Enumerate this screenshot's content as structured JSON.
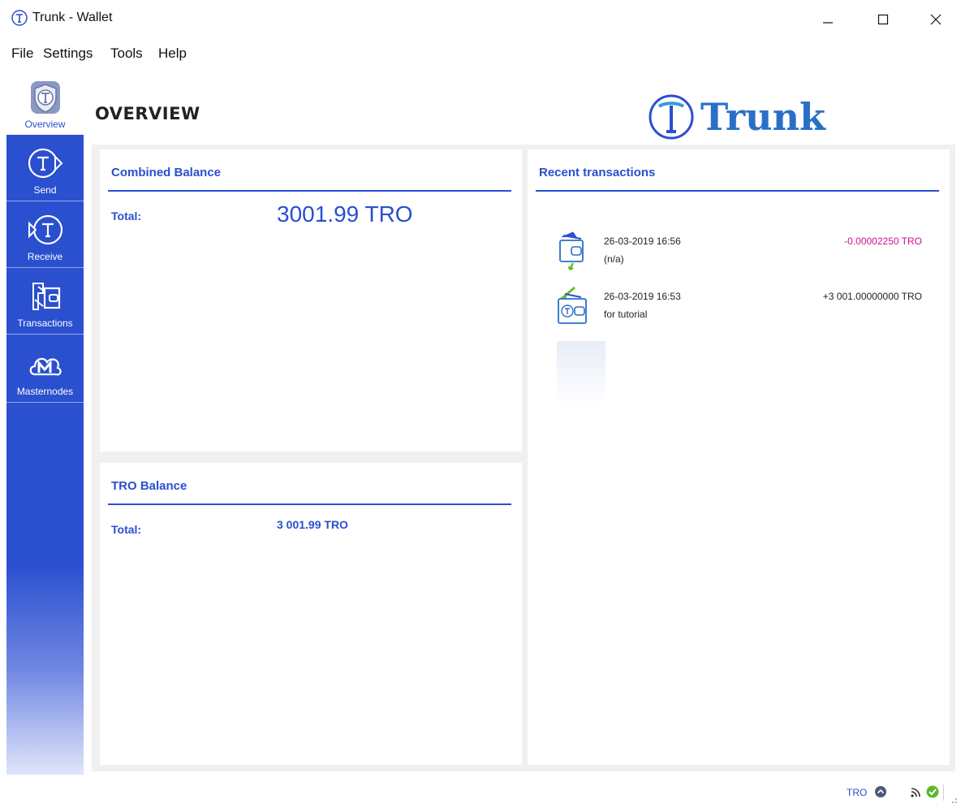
{
  "window": {
    "title": "Trunk - Wallet"
  },
  "menu": {
    "file": "File",
    "settings": "Settings",
    "tools": "Tools",
    "help": "Help"
  },
  "sidebar": {
    "items": [
      {
        "label": "Overview",
        "icon": "overview-shield-icon",
        "active": true
      },
      {
        "label": "Send",
        "icon": "send-icon",
        "active": false
      },
      {
        "label": "Receive",
        "icon": "receive-icon",
        "active": false
      },
      {
        "label": "Transactions",
        "icon": "transactions-icon",
        "active": false
      },
      {
        "label": "Masternodes",
        "icon": "masternodes-icon",
        "active": false
      }
    ]
  },
  "header": {
    "page_title": "OVERVIEW",
    "brand_name": "Trunk"
  },
  "combined_balance": {
    "heading": "Combined Balance",
    "total_label": "Total:",
    "total_value": "3001.99 TRO"
  },
  "tro_balance": {
    "heading": "TRO Balance",
    "total_label": "Total:",
    "total_value": "3 001.99 TRO"
  },
  "recent_transactions": {
    "heading": "Recent transactions",
    "items": [
      {
        "date": "26-03-2019 16:56",
        "description": "(n/a)",
        "amount": "-0.00002250 TRO",
        "icon": "wallet-send-icon"
      },
      {
        "date": "26-03-2019 16:53",
        "description": "for tutorial",
        "amount": "+3 001.00000000 TRO",
        "icon": "wallet-receive-icon"
      }
    ]
  },
  "statusbar": {
    "unit": "TRO"
  },
  "colors": {
    "accent": "#2a4fcf",
    "negative_amount": "#d0118c",
    "sync_ok": "#5cb82a"
  }
}
